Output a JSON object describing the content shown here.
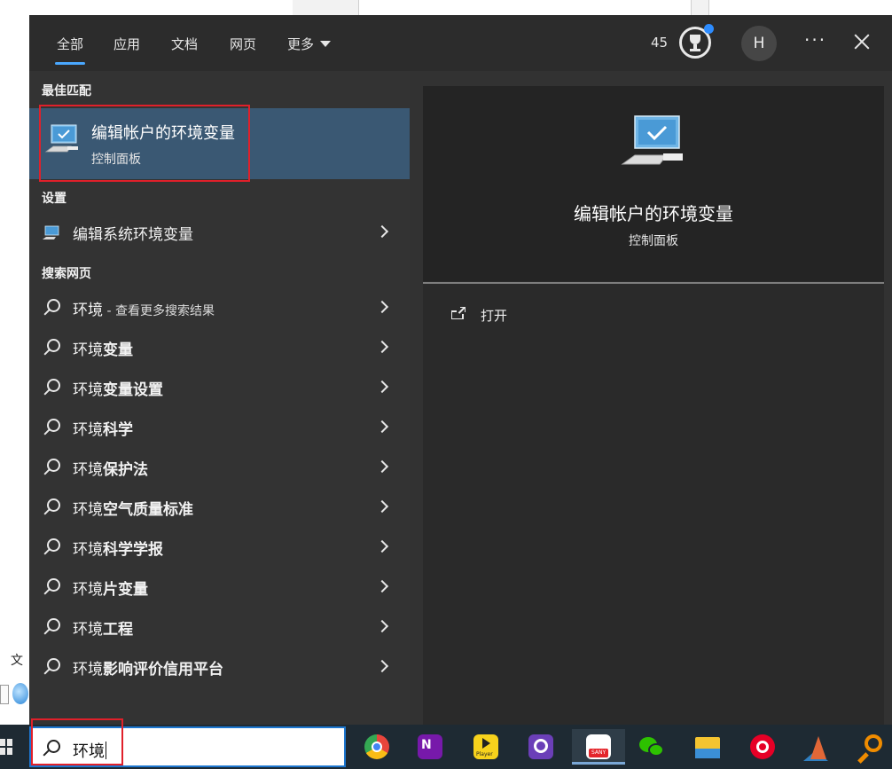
{
  "tabs": [
    {
      "label": "全部"
    },
    {
      "label": "应用"
    },
    {
      "label": "文档"
    },
    {
      "label": "网页"
    },
    {
      "label": "更多"
    }
  ],
  "header": {
    "points": "45",
    "avatar_initial": "H",
    "more_label": "···"
  },
  "background": {
    "left_text": "文"
  },
  "sections": {
    "best_match": "最佳匹配",
    "settings": "设置",
    "web_search": "搜索网页"
  },
  "best_match": {
    "title": "编辑帐户的环境变量",
    "subtitle": "控制面板"
  },
  "settings_items": [
    {
      "label": "编辑系统环境变量"
    }
  ],
  "web_results": [
    {
      "prefix": "环境",
      "bold": "",
      "suffix": " - 查看更多搜索结果"
    },
    {
      "prefix": "环境",
      "bold": "变量",
      "suffix": ""
    },
    {
      "prefix": "环境",
      "bold": "变量设置",
      "suffix": ""
    },
    {
      "prefix": "环境",
      "bold": "科学",
      "suffix": ""
    },
    {
      "prefix": "环境",
      "bold": "保护法",
      "suffix": ""
    },
    {
      "prefix": "环境",
      "bold": "空气质量标准",
      "suffix": ""
    },
    {
      "prefix": "环境",
      "bold": "科学学报",
      "suffix": ""
    },
    {
      "prefix": "环境",
      "bold": "片变量",
      "suffix": ""
    },
    {
      "prefix": "环境",
      "bold": "工程",
      "suffix": ""
    },
    {
      "prefix": "环境",
      "bold": "影响评价信用平台",
      "suffix": ""
    }
  ],
  "preview": {
    "title": "编辑帐户的环境变量",
    "subtitle": "控制面板",
    "action_open": "打开"
  },
  "search": {
    "value": "环境"
  },
  "taskbar_apps": [
    {
      "name": "chrome-icon",
      "color": "#e8453c"
    },
    {
      "name": "onenote-icon",
      "color": "#7719aa"
    },
    {
      "name": "player-icon",
      "color": "#f7d21c",
      "text": "Player"
    },
    {
      "name": "app-purple-icon",
      "color": "#6b3fb8"
    },
    {
      "name": "sany-icon",
      "color": "#e4252b",
      "text": "SANY"
    },
    {
      "name": "wechat-icon",
      "color": "#2dc100"
    },
    {
      "name": "file-explorer-icon",
      "color": "#f4c430"
    },
    {
      "name": "netease-music-icon",
      "color": "#e60026"
    },
    {
      "name": "matlab-icon",
      "color": "#e16737"
    },
    {
      "name": "search-app-icon",
      "color": "#f08c00"
    }
  ],
  "colors": {
    "accent": "#4aa8ff",
    "selection": "#3a5873",
    "highlight_box": "#e0202a",
    "search_border": "#1d77d0"
  }
}
